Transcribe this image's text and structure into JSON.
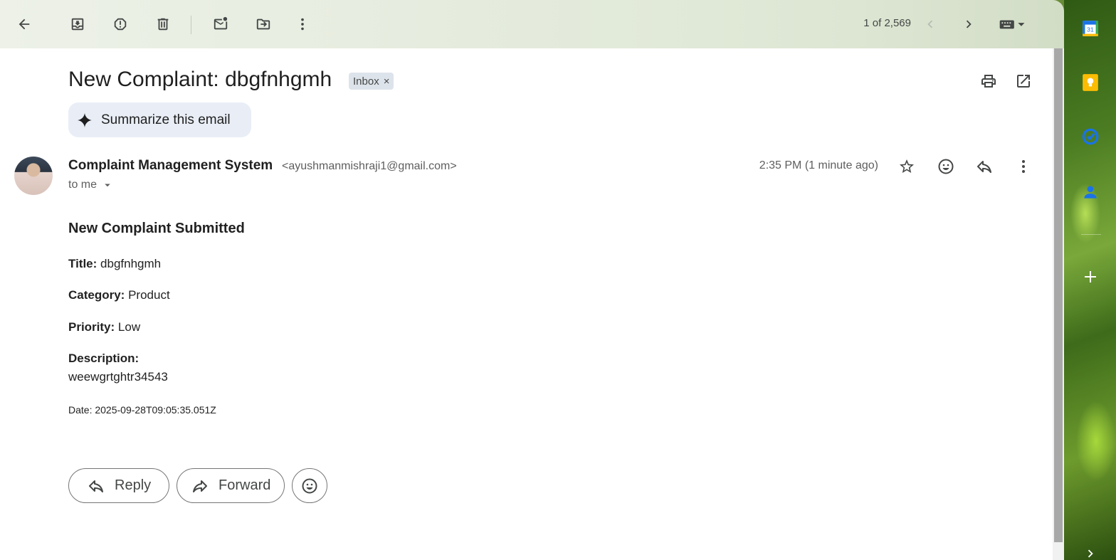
{
  "toolbar": {
    "pager": "1 of 2,569",
    "icons": [
      "back-arrow-icon",
      "archive-icon",
      "report-spam-icon",
      "delete-icon",
      "mark-unread-icon",
      "move-to-icon",
      "more-vert-icon",
      "prev-icon",
      "next-icon",
      "keyboard-icon"
    ]
  },
  "email": {
    "subject": "New Complaint: dbgfnhgmh",
    "label": "Inbox",
    "label_remove": "×",
    "summarize_label": "Summarize this email",
    "sender_name": "Complaint Management System",
    "sender_email": "<ayushmanmishraji1@gmail.com>",
    "to": "to me",
    "time": "2:35 PM (1 minute ago)",
    "body": {
      "heading": "New Complaint Submitted",
      "title_label": "Title:",
      "title_value": "dbgfnhgmh",
      "category_label": "Category:",
      "category_value": "Product",
      "priority_label": "Priority:",
      "priority_value": "Low",
      "description_label": "Description:",
      "description_value": "weewgrtghtr34543",
      "date_line": "Date: 2025-09-28T09:05:35.051Z"
    }
  },
  "actions": {
    "reply_label": "Reply",
    "forward_label": "Forward"
  },
  "side_panel": {
    "calendar_day": "31"
  },
  "colors": {
    "accent_blue": "#0b57d0",
    "keep_yellow": "#fbbc04",
    "chip_bg": "#dde3ea",
    "summarize_bg": "#e9eef6"
  }
}
